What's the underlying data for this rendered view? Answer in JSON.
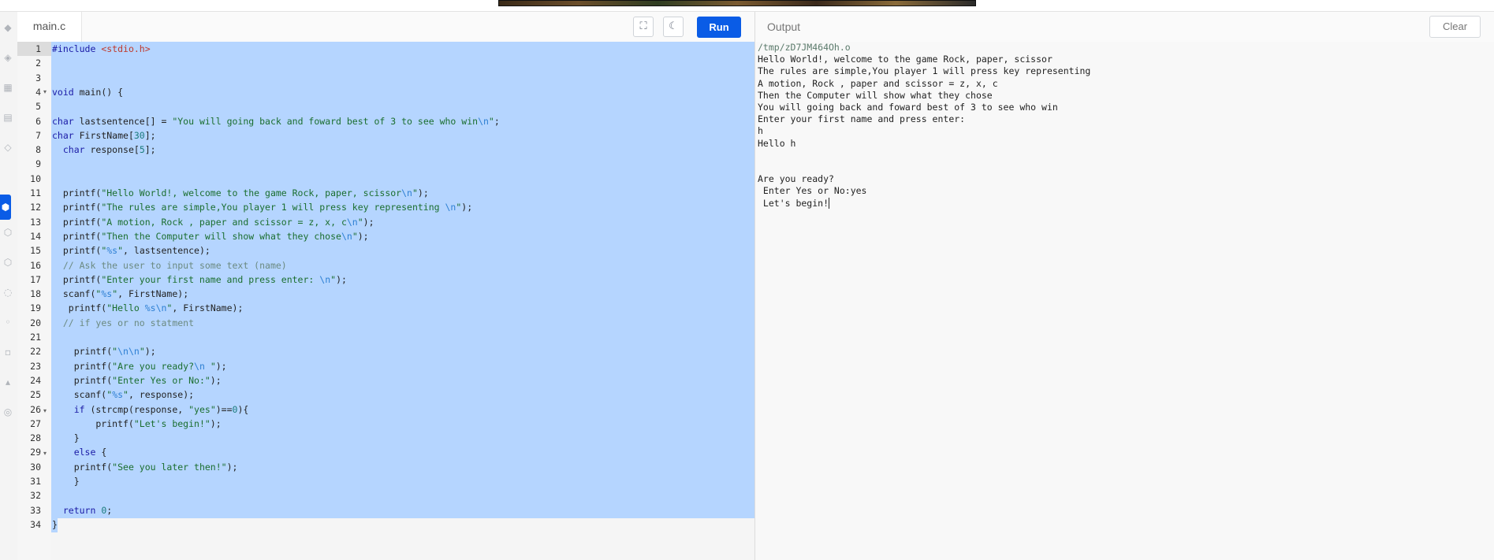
{
  "editor": {
    "file_tab": "main.c",
    "run_label": "Run",
    "lines": [
      "1",
      "2",
      "3",
      "4",
      "5",
      "6",
      "7",
      "8",
      "9",
      "10",
      "11",
      "12",
      "13",
      "14",
      "15",
      "16",
      "17",
      "18",
      "19",
      "20",
      "21",
      "22",
      "23",
      "24",
      "25",
      "26",
      "27",
      "28",
      "29",
      "30",
      "31",
      "32",
      "33",
      "34"
    ],
    "code": [
      "#include <stdio.h>",
      "",
      "",
      "void main() {",
      "",
      "char lastsentence[] = \"You will going back and foward best of 3 to see who win\\n\";",
      "char FirstName[30];",
      "  char response[5];",
      "",
      "",
      "  printf(\"Hello World!, welcome to the game Rock, paper, scissor\\n\");",
      "  printf(\"The rules are simple,You player 1 will press key representing \\n\");",
      "  printf(\"A motion, Rock , paper and scissor = z, x, c\\n\");",
      "  printf(\"Then the Computer will show what they chose\\n\");",
      "  printf(\"%s\", lastsentence);",
      "  // Ask the user to input some text (name)",
      "  printf(\"Enter your first name and press enter: \\n\");",
      "  scanf(\"%s\", FirstName);",
      "   printf(\"Hello %s\\n\", FirstName);",
      "  // if yes or no statment",
      "",
      "    printf(\"\\n\\n\");",
      "    printf(\"Are you ready?\\n \");",
      "    printf(\"Enter Yes or No:\");",
      "    scanf(\"%s\", response);",
      "    if (strcmp(response, \"yes\")==0){",
      "        printf(\"Let's begin!\");",
      "    }",
      "    else {",
      "    printf(\"See you later then!\");",
      "    }",
      "",
      "  return 0;",
      "}"
    ]
  },
  "output": {
    "title": "Output",
    "clear_label": "Clear",
    "lines": [
      "/tmp/zD7JM464Oh.o",
      "Hello World!, welcome to the game Rock, paper, scissor",
      "The rules are simple,You player 1 will press key representing",
      "A motion, Rock , paper and scissor = z, x, c",
      "Then the Computer will show what they chose",
      "You will going back and foward best of 3 to see who win",
      "Enter your first name and press enter:",
      "h",
      "Hello h",
      "",
      "",
      "Are you ready?",
      " Enter Yes or No:yes",
      " Let's begin!"
    ]
  },
  "icons": {
    "fullscreen": "fullscreen-icon",
    "theme": "moon-icon"
  }
}
